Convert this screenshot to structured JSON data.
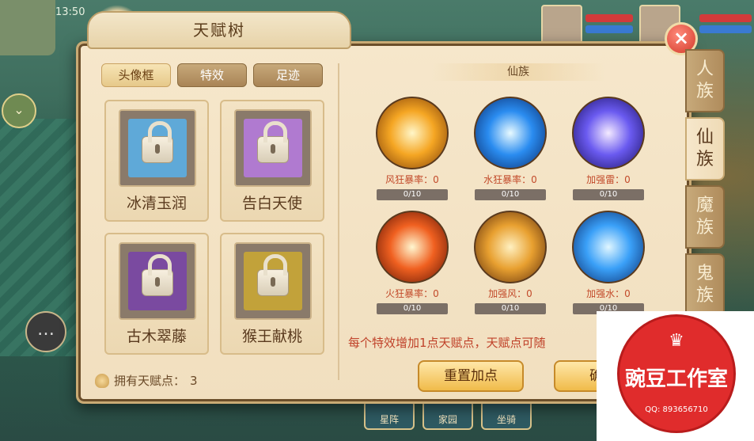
{
  "hud": {
    "clock": "13:50"
  },
  "panel": {
    "title": "天赋树",
    "close_icon": "×"
  },
  "subtabs": [
    {
      "label": "头像框",
      "active": true
    },
    {
      "label": "特效",
      "active": false
    },
    {
      "label": "足迹",
      "active": false
    }
  ],
  "frames": [
    {
      "label": "冰清玉润",
      "accent": "#5fa9d8"
    },
    {
      "label": "告白天使",
      "accent": "#b07ad0"
    },
    {
      "label": "古木翠藤",
      "accent": "#7a4aa0"
    },
    {
      "label": "猴王献桃",
      "accent": "#c2a23a"
    }
  ],
  "points": {
    "label": "拥有天赋点：",
    "value": "3"
  },
  "race": {
    "title": "仙族",
    "effects": [
      {
        "label": "风狂暴率：0",
        "progress": "0/10",
        "color": "#f5a623"
      },
      {
        "label": "水狂暴率：0",
        "progress": "0/10",
        "color": "#2a8cf0"
      },
      {
        "label": "加强雷：0",
        "progress": "0/10",
        "color": "#6a5af0"
      },
      {
        "label": "火狂暴率：0",
        "progress": "0/10",
        "color": "#f06020"
      },
      {
        "label": "加强风：0",
        "progress": "0/10",
        "color": "#e8a030"
      },
      {
        "label": "加强水：0",
        "progress": "0/10",
        "color": "#3aa0f8"
      }
    ],
    "hint": "每个特效增加1点天赋点，天赋点可随",
    "reset_button": "重置加点",
    "confirm_button": "确认"
  },
  "race_tabs": [
    {
      "label": "人族",
      "active": false
    },
    {
      "label": "仙族",
      "active": true
    },
    {
      "label": "魔族",
      "active": false
    },
    {
      "label": "鬼族",
      "active": false
    }
  ],
  "bottom_tabs": [
    "星阵",
    "家园",
    "坐骑"
  ],
  "watermark": {
    "name": "豌豆工作室",
    "qq": "QQ: 893656710"
  }
}
